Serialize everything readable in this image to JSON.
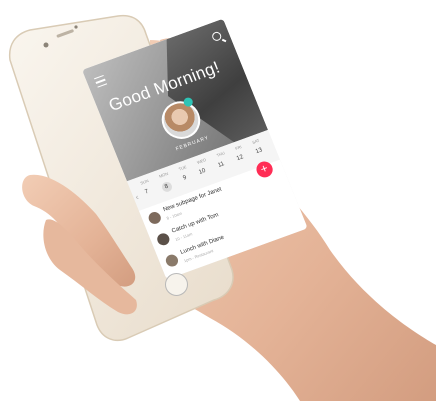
{
  "header": {
    "greeting": "Good Morning!",
    "month": "FEBRUARY"
  },
  "calendar": {
    "weekdays": [
      "SUN",
      "MON",
      "TUE",
      "WED",
      "THU",
      "FRI",
      "SAT"
    ],
    "days": [
      "7",
      "8",
      "9",
      "10",
      "11",
      "12",
      "13"
    ],
    "selected_day": "8"
  },
  "events": [
    {
      "title": "New subpage for Janet",
      "subtitle": "8 - 10am"
    },
    {
      "title": "Catch up with Tom",
      "subtitle": "10 - 11am"
    },
    {
      "title": "Lunch with Diane",
      "subtitle": "1pm - Restaurant"
    }
  ],
  "fab": {
    "label": "+"
  },
  "colors": {
    "accent": "#ff2d55",
    "status": "#2ec4b6",
    "phone_gold": "#f3ece2"
  }
}
